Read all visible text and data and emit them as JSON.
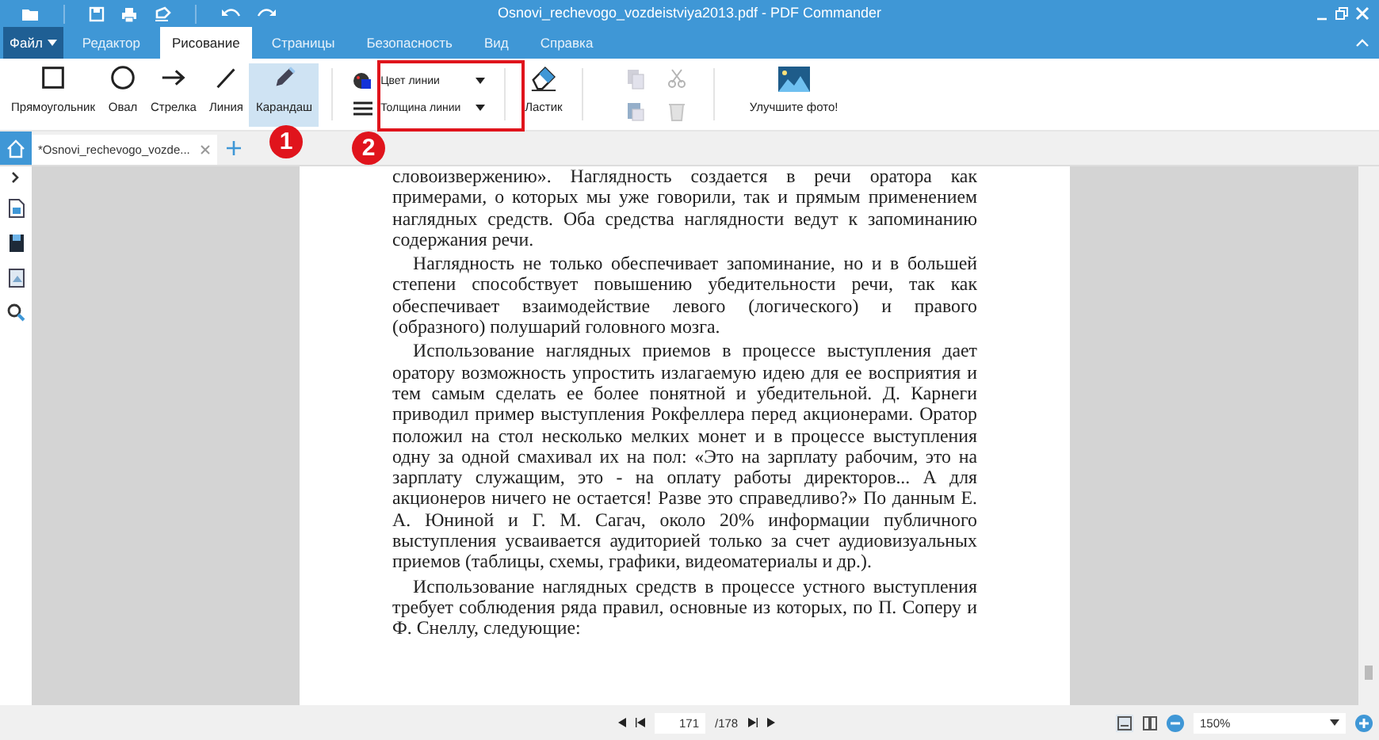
{
  "window": {
    "title": "Osnovi_rechevogo_vozdeistviya2013.pdf - PDF Commander"
  },
  "file_menu": {
    "label": "Файл"
  },
  "menu_tabs": [
    {
      "label": "Редактор",
      "selected": false
    },
    {
      "label": "Рисование",
      "selected": true
    },
    {
      "label": "Страницы",
      "selected": false
    },
    {
      "label": "Безопасность",
      "selected": false
    },
    {
      "label": "Вид",
      "selected": false
    },
    {
      "label": "Справка",
      "selected": false
    }
  ],
  "draw_tools": [
    {
      "kind": "rectangle",
      "label": "Прямоугольник",
      "selected": false
    },
    {
      "kind": "oval",
      "label": "Овал",
      "selected": false
    },
    {
      "kind": "arrow",
      "label": "Стрелка",
      "selected": false
    },
    {
      "kind": "line",
      "label": "Линия",
      "selected": false
    },
    {
      "kind": "pencil",
      "label": "Карандаш",
      "selected": true
    }
  ],
  "line_options": [
    {
      "kind": "color",
      "label": "Цвет линии"
    },
    {
      "kind": "width",
      "label": "Толщина линии"
    }
  ],
  "eraser": {
    "label": "Ластик"
  },
  "edit_tools": [
    {
      "kind": "copy",
      "disabled": true
    },
    {
      "kind": "cut",
      "disabled": true
    },
    {
      "kind": "paste",
      "disabled": true
    },
    {
      "kind": "delete",
      "disabled": true
    }
  ],
  "photo_tool": {
    "label": "Улучшите фото!"
  },
  "doc_tabs": [
    {
      "label": "*Osnovi_rechevogo_vozde...",
      "selected": true
    }
  ],
  "callouts": [
    {
      "label": "1"
    },
    {
      "label": "2"
    }
  ],
  "document": {
    "paragraphs": [
      {
        "indent": false,
        "text": "словоизвержению». Наглядность создается в речи оратора как примерами, о которых мы уже говорили, так и прямым применением наглядных средств. Оба средства наглядности ведут к запоминанию содержания речи."
      },
      {
        "indent": true,
        "text": "Наглядность не только обеспечивает запоминание, но и в большей степени способствует повышению убедительности речи, так как обеспечивает взаимодействие левого (логического) и правого (образного) полушарий головного мозга."
      },
      {
        "indent": true,
        "text": "Использование наглядных приемов в процессе выступления дает оратору возможность упростить излагаемую идею для ее восприятия и тем самым сделать ее более понятной и убедительной. Д. Карнеги приводил пример выступления Рокфеллера  перед акционерами. Оратор положил на стол несколько мелких монет и в процессе выступления одну за одной смахивал их на пол: «Это на зарплату рабочим, это на зарплату служащим, это - на оплату работы директоров... А для акционеров ничего не остается! Разве это справедливо?» По данным Е. А. Юниной и Г. М. Сагач, около 20% информации публичного выступления усваивается аудиторией только за счет аудиовизуальных приемов (таблицы, схемы, графики, видеоматериалы и др.)."
      },
      {
        "indent": true,
        "text": "Использование наглядных средств в процессе устного выступления требует соблюдения ряда правил, основные из которых, по П. Соперу и Ф. Снеллу, следующие:"
      }
    ]
  },
  "status_bar": {
    "page": "171",
    "total": "/178",
    "zoom": "150%"
  }
}
